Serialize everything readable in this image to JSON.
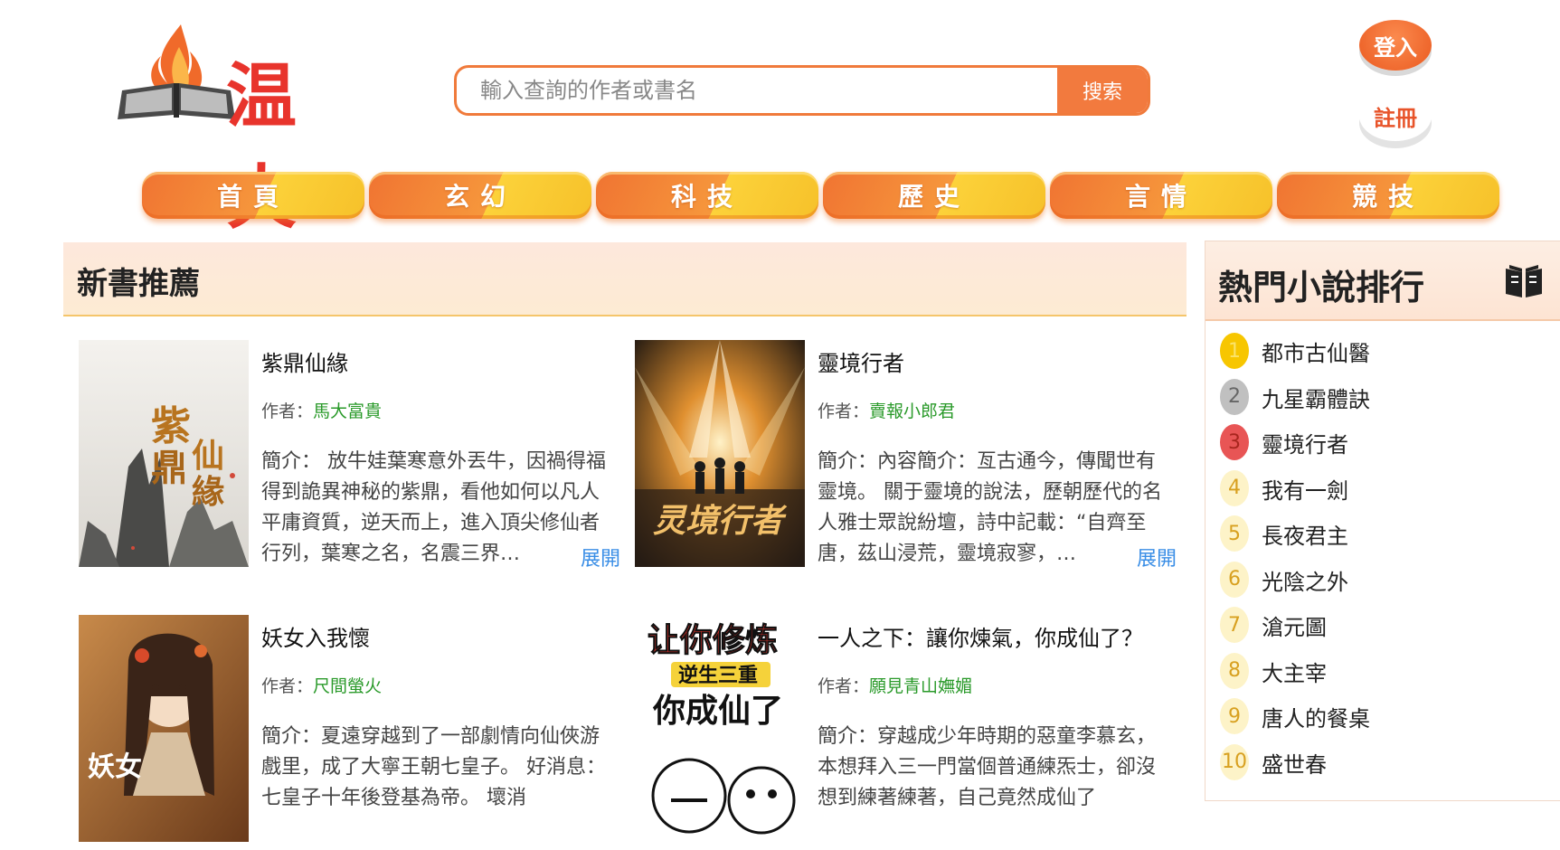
{
  "header": {
    "logo_text": "温火",
    "search_placeholder": "輸入查詢的作者或書名",
    "search_button": "搜索",
    "login": "登入",
    "register": "註冊"
  },
  "nav": [
    "首頁",
    "玄幻",
    "科技",
    "歷史",
    "言情",
    "競技"
  ],
  "new_books": {
    "title": "新書推薦",
    "author_label": "作者：",
    "intro_label": "簡介：",
    "expand": "展開",
    "books": [
      {
        "title": "紫鼎仙緣",
        "author": "馬大富貴",
        "intro": " 放牛娃葉寒意外丟牛，因禍得福得到詭異神秘的紫鼎，看他如何以凡人平庸資質，逆天而上，進入頂尖修仙者行列，葉寒之名，名震三界…"
      },
      {
        "title": "靈境行者",
        "author": "賣報小郎君",
        "intro": "內容簡介：亙古通今，傳聞世有靈境。 關于靈境的說法，歷朝歷代的名人雅士眾說紛壇，詩中記載：“自齊至唐，茲山浸荒，靈境寂寥，…"
      },
      {
        "title": "妖女入我懷",
        "author": "尺間螢火",
        "intro": "夏遠穿越到了一部劇情向仙俠游戲里，成了大寧王朝七皇子。 好消息：七皇子十年後登基為帝。 壞消"
      },
      {
        "title": "一人之下：讓你煉氣，你成仙了？",
        "author": "願見青山嫵媚",
        "intro": "穿越成少年時期的惡童李慕玄，本想拜入三一門當個普通練炁士，卻沒想到練著練著，自己竟然成仙了"
      }
    ]
  },
  "ranking": {
    "title": "熱門小說排行",
    "icon": "book-icon",
    "items": [
      {
        "rank": "1",
        "name": "都市古仙醫"
      },
      {
        "rank": "2",
        "name": "九星霸體訣"
      },
      {
        "rank": "3",
        "name": "靈境行者"
      },
      {
        "rank": "4",
        "name": "我有一劍"
      },
      {
        "rank": "5",
        "name": "長夜君主"
      },
      {
        "rank": "6",
        "name": "光陰之外"
      },
      {
        "rank": "7",
        "name": "滄元圖"
      },
      {
        "rank": "8",
        "name": "大主宰"
      },
      {
        "rank": "9",
        "name": "唐人的餐桌"
      },
      {
        "rank": "10",
        "name": "盛世春"
      }
    ]
  },
  "colors": {
    "accent": "#f27a3e",
    "rank1": "#f7c600",
    "rank2": "#c0c0c0",
    "rank3": "#e85555",
    "rank_other": "#fdf3c8",
    "author_link": "#2a9a2a",
    "expand_link": "#3a8ee6"
  }
}
